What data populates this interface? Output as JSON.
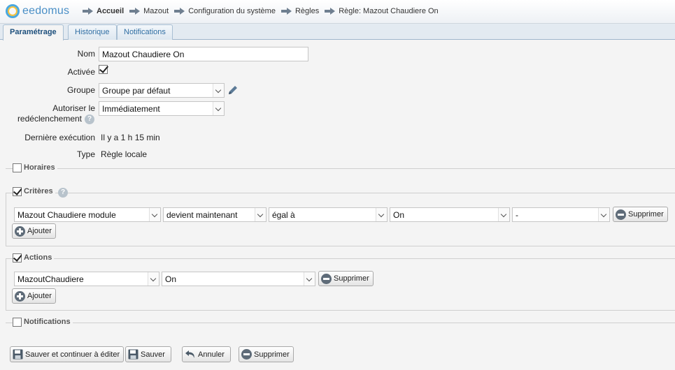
{
  "header": {
    "logo_text": "eedomus",
    "breadcrumb": [
      {
        "label": "Accueil",
        "bold": true
      },
      {
        "label": "Mazout",
        "bold": false
      },
      {
        "label": "Configuration du système",
        "bold": false
      },
      {
        "label": "Règles",
        "bold": false
      },
      {
        "label": "Règle: Mazout Chaudiere On",
        "bold": false
      }
    ]
  },
  "tabs": [
    {
      "label": "Paramétrage",
      "active": true
    },
    {
      "label": "Historique",
      "active": false
    },
    {
      "label": "Notifications",
      "active": false
    }
  ],
  "form": {
    "nom_label": "Nom",
    "nom_value": "Mazout Chaudiere On",
    "activee_label": "Activée",
    "activee_checked": true,
    "groupe_label": "Groupe",
    "groupe_value": "Groupe par défaut",
    "autoriser_label_line1": "Autoriser le",
    "autoriser_label_line2": "redéclenchement",
    "autoriser_value": "Immédiatement",
    "derniere_label": "Dernière exécution",
    "derniere_value": "Il y a 1 h 15 min",
    "type_label": "Type",
    "type_value": "Règle locale",
    "help_glyph": "?"
  },
  "sections": {
    "horaires": {
      "title": "Horaires",
      "checked": false
    },
    "criteres": {
      "title": "Critères",
      "checked": true,
      "row": {
        "module": "Mazout Chaudiere module",
        "condition": "devient maintenant",
        "operator": "égal à",
        "value": "On",
        "extra": "-",
        "delete_label": "Supprimer"
      },
      "add_label": "Ajouter"
    },
    "actions": {
      "title": "Actions",
      "checked": true,
      "row": {
        "target": "MazoutChaudiere",
        "value": "On",
        "delete_label": "Supprimer"
      },
      "add_label": "Ajouter"
    },
    "notifications": {
      "title": "Notifications",
      "checked": false
    }
  },
  "footer": {
    "save_continue_label": "Sauver et continuer à éditer",
    "save_label": "Sauver",
    "cancel_label": "Annuler",
    "delete_label": "Supprimer"
  },
  "colors": {
    "accent": "#2f6ea3",
    "logo_blue": "#4aa8e0",
    "logo_yellow": "#f6c23a"
  }
}
